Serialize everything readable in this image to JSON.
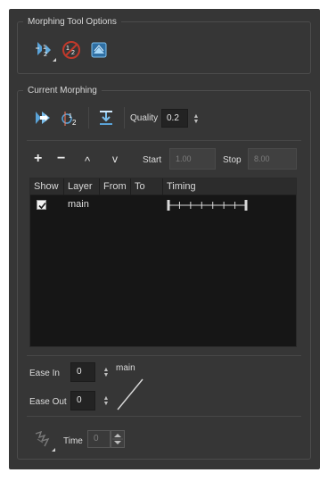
{
  "morphing_tool_options": {
    "title": "Morphing Tool Options",
    "tools": [
      {
        "name": "create-morphing-icon",
        "has_submenu": true
      },
      {
        "name": "delete-hint-icon",
        "has_submenu": false
      },
      {
        "name": "show-hints-icon",
        "has_submenu": false
      }
    ]
  },
  "current_morphing": {
    "title": "Current Morphing",
    "tools": [
      "go-to-first-morphing-icon",
      "go-to-second-morphing-icon",
      "convert-to-drawing-icon"
    ],
    "quality_label": "Quality",
    "quality_value": "0.2",
    "list_toolbar": {
      "add": "+",
      "remove": "−",
      "up": "^",
      "down": "v",
      "start_label": "Start",
      "start_value": "1.00",
      "stop_label": "Stop",
      "stop_value": "8.00"
    },
    "columns": [
      "Show",
      "Layer",
      "From",
      "To",
      "Timing"
    ],
    "rows": [
      {
        "show": true,
        "layer": "main",
        "from": "",
        "to": "",
        "timing_ticks": 8
      }
    ],
    "ease_in_label": "Ease In",
    "ease_in_value": "0",
    "ease_out_label": "Ease Out",
    "ease_out_value": "0",
    "curve_label": "main",
    "time_label": "Time",
    "time_value": "0"
  }
}
